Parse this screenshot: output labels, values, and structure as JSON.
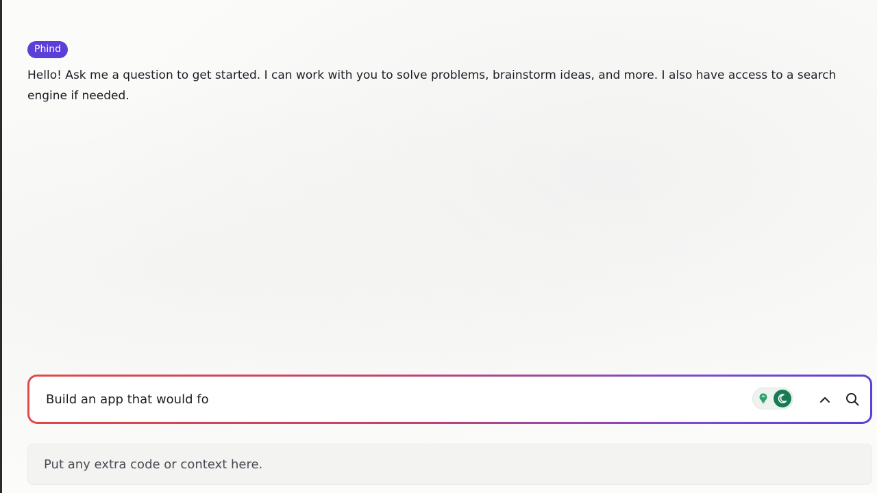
{
  "assistant": {
    "badge_label": "Phind",
    "greeting": "Hello! Ask me a question to get started. I can work with you to solve problems, brainstorm ideas, and more. I also have access to a search engine if needed.",
    "badge_color": "#5b3fd8"
  },
  "query": {
    "value": "Build an app that would fo"
  },
  "context": {
    "placeholder": "Put any extra code or context here."
  },
  "controls": {
    "toggle_left_icon": "bulb-icon",
    "toggle_right_icon": "moon-icon",
    "expand_icon": "chevron-up-icon",
    "submit_icon": "search-icon",
    "accent_green": "#1a7a55"
  }
}
